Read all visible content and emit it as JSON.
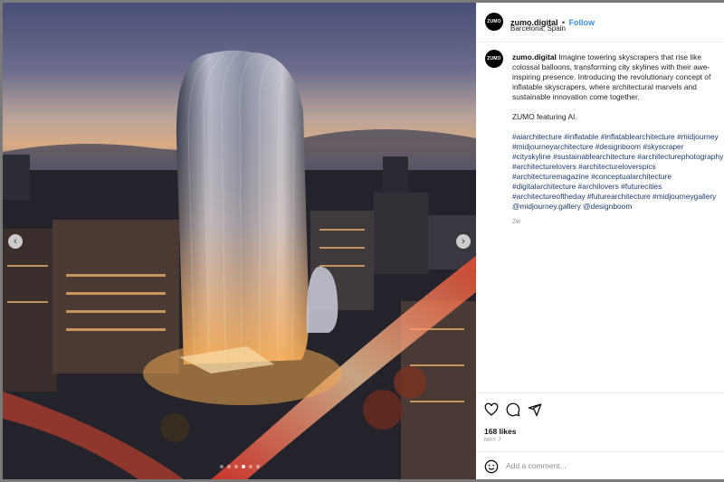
{
  "post": {
    "username": "zumo.digital",
    "separator": "•",
    "follow_label": "Follow",
    "location": "Barcelona, Spain",
    "avatar_text": "ZUMO",
    "caption": "Imagine towering skyscrapers that rise like colossal balloons, transforming city skylines with their awe-inspiring presence. Introducing the revolutionary concept of inflatable skyscrapers, where architectural marvels and sustainable innovation come together.",
    "caption_line2": "ZUMO featuring AI.",
    "hashtags": [
      "#aiarchitecture",
      "#inflatable",
      "#inflatablearchitecture",
      "#midjourney",
      "#midjourneyarchitecture",
      "#designboom",
      "#skyscraper",
      "#cityskyline",
      "#sustainablearchitecture",
      "#architecturephotography",
      "#architecturelovers",
      "#architectureloverspics",
      "#architecturemagazine",
      "#conceptualarchitecture",
      "#digitalarchitecture",
      "#archilovers",
      "#futurecities",
      "#architectureoftheday",
      "#futurearchitecture",
      "#midjourneygallery",
      "@midjourney.gallery",
      "@designboom"
    ],
    "time_ago": "2w",
    "likes": "168 likes",
    "date": "MAY 7",
    "comment_placeholder": "Add a comment..."
  },
  "carousel": {
    "prev_icon": "‹",
    "next_icon": "›",
    "slide_count": 6,
    "active_slide": 3
  },
  "icons": {
    "like": "heart-icon",
    "comment": "comment-bubble-icon",
    "share": "paper-plane-icon",
    "emoji": "smiley-icon"
  }
}
